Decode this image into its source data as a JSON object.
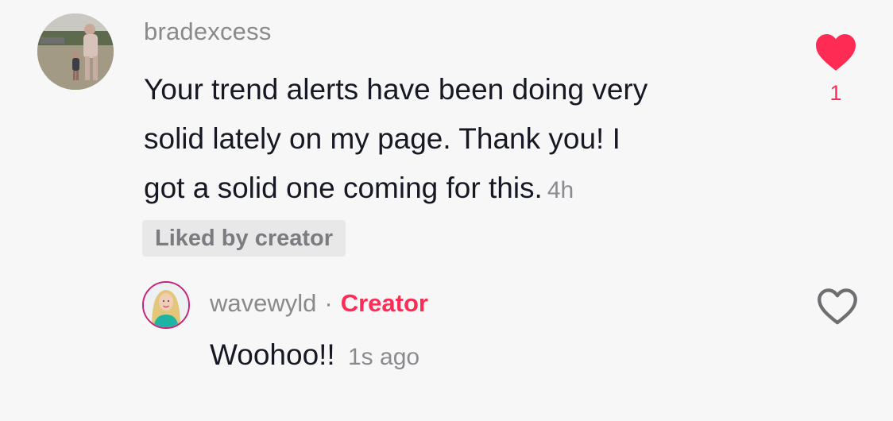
{
  "comment": {
    "username": "bradexcess",
    "text_lines": [
      "Your trend alerts have been doing very",
      "solid lately on my page. Thank you! I",
      "got a solid one coming for this."
    ],
    "time": "4h",
    "liked_badge": "Liked by creator",
    "like_count": "1",
    "liked": true,
    "like_icon": "heart-filled-icon"
  },
  "reply": {
    "username": "wavewyld",
    "separator": "·",
    "creator_label": "Creator",
    "text": "Woohoo!!",
    "time": "1s ago",
    "liked": false,
    "like_icon": "heart-outline-icon"
  },
  "colors": {
    "accent": "#fe2c55",
    "avatar_ring": "#c6247a",
    "text_primary": "#161823",
    "text_secondary": "#8a8a8a"
  }
}
